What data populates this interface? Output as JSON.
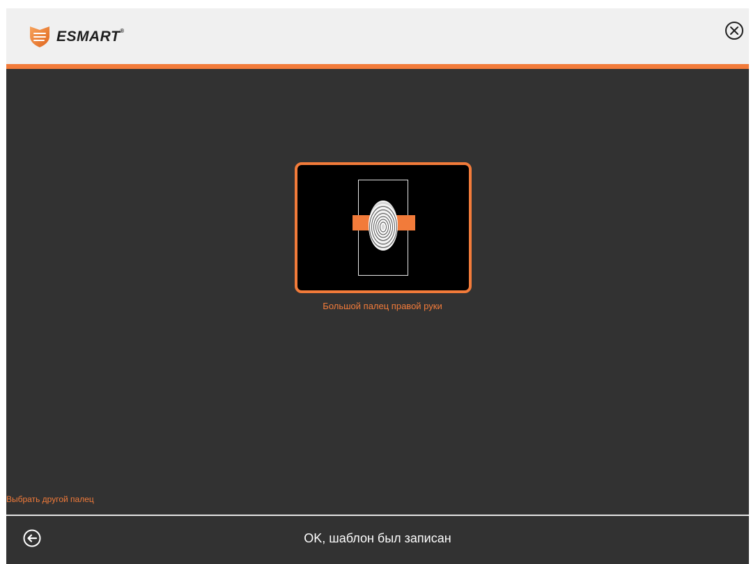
{
  "app": {
    "logo_text": "ESMART",
    "logo_mark": "®",
    "close_icon": "close-circle-icon"
  },
  "colors": {
    "accent": "#f27b3a",
    "background": "#323232",
    "titlebar": "#f0f0f0",
    "text": "#ffffff"
  },
  "finger": {
    "label": "Большой палец правой руки",
    "selected": true
  },
  "actions": {
    "choose_other": "Выбрать другой палец",
    "back_icon": "back-arrow-icon"
  },
  "status": {
    "message": "OK, шаблон был записан"
  }
}
